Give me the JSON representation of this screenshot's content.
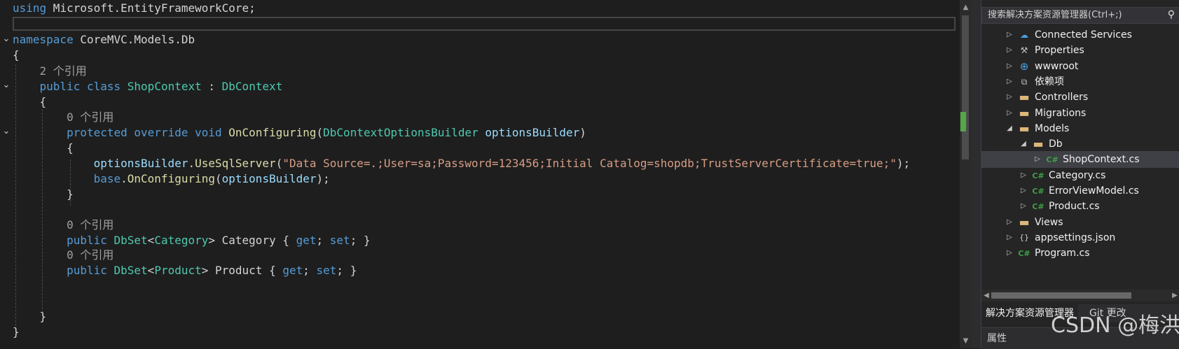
{
  "code_lines": [
    {
      "segments": [
        {
          "c": "k",
          "t": "using"
        },
        {
          "c": "x",
          "t": " Microsoft.EntityFrameworkCore;"
        }
      ]
    },
    {
      "segments": []
    },
    {
      "segments": [
        {
          "c": "k",
          "t": "namespace"
        },
        {
          "c": "x",
          "t": " CoreMVC.Models.Db"
        }
      ]
    },
    {
      "segments": [
        {
          "c": "x",
          "t": "{"
        }
      ]
    },
    {
      "segments": [
        {
          "c": "r",
          "t": "    2 个引用"
        }
      ]
    },
    {
      "segments": [
        {
          "c": "k",
          "t": "    public"
        },
        {
          "c": "x",
          "t": " "
        },
        {
          "c": "k",
          "t": "class"
        },
        {
          "c": "x",
          "t": " "
        },
        {
          "c": "t",
          "t": "ShopContext"
        },
        {
          "c": "x",
          "t": " : "
        },
        {
          "c": "t",
          "t": "DbContext"
        }
      ]
    },
    {
      "segments": [
        {
          "c": "x",
          "t": "    {"
        }
      ]
    },
    {
      "segments": [
        {
          "c": "r",
          "t": "        0 个引用"
        }
      ]
    },
    {
      "segments": [
        {
          "c": "k",
          "t": "        protected"
        },
        {
          "c": "x",
          "t": " "
        },
        {
          "c": "k",
          "t": "override"
        },
        {
          "c": "x",
          "t": " "
        },
        {
          "c": "k",
          "t": "void"
        },
        {
          "c": "x",
          "t": " "
        },
        {
          "c": "m",
          "t": "OnConfiguring"
        },
        {
          "c": "x",
          "t": "("
        },
        {
          "c": "t",
          "t": "DbContextOptionsBuilder"
        },
        {
          "c": "x",
          "t": " "
        },
        {
          "c": "p",
          "t": "optionsBuilder"
        },
        {
          "c": "x",
          "t": ")"
        }
      ]
    },
    {
      "segments": [
        {
          "c": "x",
          "t": "        {"
        }
      ]
    },
    {
      "segments": [
        {
          "c": "p",
          "t": "            optionsBuilder"
        },
        {
          "c": "x",
          "t": "."
        },
        {
          "c": "m",
          "t": "UseSqlServer"
        },
        {
          "c": "x",
          "t": "("
        },
        {
          "c": "s",
          "t": "\"Data Source=.;User=sa;Password=123456;Initial Catalog=shopdb;TrustServerCertificate=true;\""
        },
        {
          "c": "x",
          "t": ");"
        }
      ]
    },
    {
      "segments": [
        {
          "c": "k",
          "t": "            base"
        },
        {
          "c": "x",
          "t": "."
        },
        {
          "c": "m",
          "t": "OnConfiguring"
        },
        {
          "c": "x",
          "t": "("
        },
        {
          "c": "p",
          "t": "optionsBuilder"
        },
        {
          "c": "x",
          "t": ");"
        }
      ]
    },
    {
      "segments": [
        {
          "c": "x",
          "t": "        }"
        }
      ]
    },
    {
      "segments": []
    },
    {
      "segments": [
        {
          "c": "r",
          "t": "        0 个引用"
        }
      ]
    },
    {
      "segments": [
        {
          "c": "k",
          "t": "        public"
        },
        {
          "c": "x",
          "t": " "
        },
        {
          "c": "t",
          "t": "DbSet"
        },
        {
          "c": "x",
          "t": "<"
        },
        {
          "c": "t",
          "t": "Category"
        },
        {
          "c": "x",
          "t": "> Category { "
        },
        {
          "c": "k",
          "t": "get"
        },
        {
          "c": "x",
          "t": "; "
        },
        {
          "c": "k",
          "t": "set"
        },
        {
          "c": "x",
          "t": "; }"
        }
      ]
    },
    {
      "segments": [
        {
          "c": "r",
          "t": "        0 个引用"
        }
      ]
    },
    {
      "segments": [
        {
          "c": "k",
          "t": "        public"
        },
        {
          "c": "x",
          "t": " "
        },
        {
          "c": "t",
          "t": "DbSet"
        },
        {
          "c": "x",
          "t": "<"
        },
        {
          "c": "t",
          "t": "Product"
        },
        {
          "c": "x",
          "t": "> Product { "
        },
        {
          "c": "k",
          "t": "get"
        },
        {
          "c": "x",
          "t": "; "
        },
        {
          "c": "k",
          "t": "set"
        },
        {
          "c": "x",
          "t": "; }"
        }
      ]
    },
    {
      "segments": []
    },
    {
      "segments": []
    },
    {
      "segments": [
        {
          "c": "x",
          "t": "    }"
        }
      ]
    },
    {
      "segments": [
        {
          "c": "x",
          "t": "}"
        }
      ]
    }
  ],
  "colors": {
    "keyword": "#569cd6",
    "type": "#4ec9b0",
    "method": "#dcdcaa",
    "param": "#9cdcfe",
    "string": "#d69d85",
    "text": "#d4d4d4",
    "codelens": "#a0a0a0"
  },
  "solution_explorer": {
    "search_placeholder": "搜索解决方案资源管理器(Ctrl+;)",
    "items": [
      {
        "label": "Connected Services",
        "icon": "connected-services-icon",
        "expanded": false
      },
      {
        "label": "Properties",
        "icon": "wrench-icon",
        "expanded": false
      },
      {
        "label": "wwwroot",
        "icon": "globe-icon",
        "expanded": false
      },
      {
        "label": "依赖项",
        "icon": "dependencies-icon",
        "expanded": false
      },
      {
        "label": "Controllers",
        "icon": "folder-icon",
        "expanded": false
      },
      {
        "label": "Migrations",
        "icon": "folder-icon",
        "expanded": false
      },
      {
        "label": "Models",
        "icon": "folder-icon",
        "expanded": true
      },
      {
        "label": "Db",
        "icon": "folder-icon",
        "expanded": true
      },
      {
        "label": "ShopContext.cs",
        "icon": "csharp-file-icon",
        "expanded": false,
        "selected": true
      },
      {
        "label": "Category.cs",
        "icon": "csharp-file-icon",
        "expanded": false
      },
      {
        "label": "ErrorViewModel.cs",
        "icon": "csharp-file-icon",
        "expanded": false
      },
      {
        "label": "Product.cs",
        "icon": "csharp-file-icon",
        "expanded": false
      },
      {
        "label": "Views",
        "icon": "folder-icon",
        "expanded": false
      },
      {
        "label": "appsettings.json",
        "icon": "json-file-icon",
        "expanded": false
      },
      {
        "label": "Program.cs",
        "icon": "csharp-file-icon",
        "expanded": false
      }
    ],
    "tabs": [
      "解决方案资源管理器",
      "Git 更改"
    ],
    "properties_title": "属性"
  },
  "watermark": "CSDN @梅洪"
}
